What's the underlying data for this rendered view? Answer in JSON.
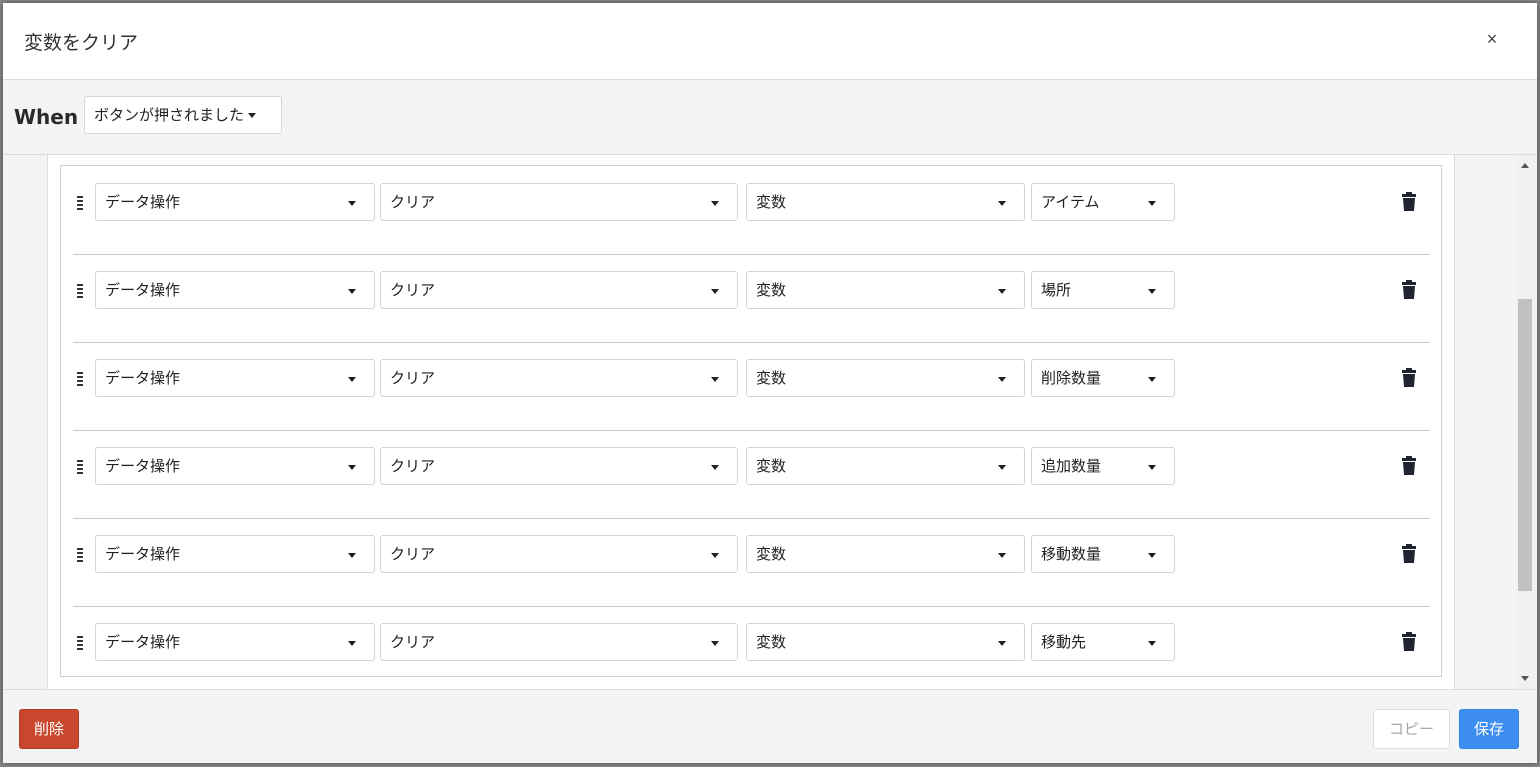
{
  "modal": {
    "title": "変数をクリア",
    "close_label": "×"
  },
  "trigger": {
    "label": "When",
    "selected": "ボタンが押されました"
  },
  "actions": [
    {
      "type": "データ操作",
      "operation": "クリア",
      "target": "変数",
      "variable": "アイテム"
    },
    {
      "type": "データ操作",
      "operation": "クリア",
      "target": "変数",
      "variable": "場所"
    },
    {
      "type": "データ操作",
      "operation": "クリア",
      "target": "変数",
      "variable": "削除数量"
    },
    {
      "type": "データ操作",
      "operation": "クリア",
      "target": "変数",
      "variable": "追加数量"
    },
    {
      "type": "データ操作",
      "operation": "クリア",
      "target": "変数",
      "variable": "移動数量"
    },
    {
      "type": "データ操作",
      "operation": "クリア",
      "target": "変数",
      "variable": "移動先"
    }
  ],
  "footer": {
    "delete_label": "削除",
    "copy_label": "コピー",
    "save_label": "保存"
  },
  "icons": {
    "drag": "drag-handle-icon",
    "trash": "trash-icon",
    "caret": "caret-down-icon",
    "close": "close-icon"
  },
  "colors": {
    "delete": "#c9472d",
    "save": "#3d8ef0"
  }
}
